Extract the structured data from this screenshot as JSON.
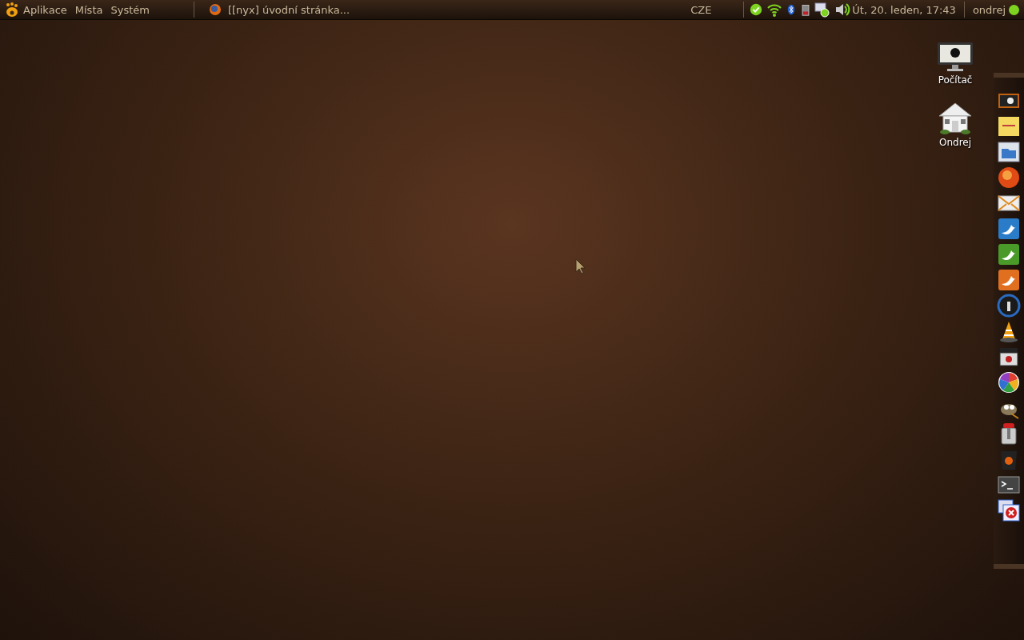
{
  "top_panel": {
    "menus": [
      {
        "label": "Aplikace"
      },
      {
        "label": "Místa"
      },
      {
        "label": "Systém"
      }
    ],
    "taskbar": [
      {
        "label": "[[nyx] úvodní stránka...",
        "selected": false
      }
    ],
    "keyboard_layout": "CZE",
    "tray": [
      {
        "kind": "chat"
      },
      {
        "kind": "wifi"
      },
      {
        "kind": "bluetooth"
      },
      {
        "kind": "battery"
      },
      {
        "kind": "messages"
      },
      {
        "kind": "volume"
      }
    ],
    "clock": "Út, 20. leden, 17:43",
    "user": {
      "name": "ondrej",
      "color": "#7ed321"
    }
  },
  "desktop_icons": [
    {
      "kind": "computer",
      "label": "Počítač"
    },
    {
      "kind": "home",
      "label": "Ondrej"
    }
  ],
  "dock": [
    {
      "kind": "screenshot"
    },
    {
      "kind": "note"
    },
    {
      "kind": "folder"
    },
    {
      "kind": "browser"
    },
    {
      "kind": "mail"
    },
    {
      "kind": "bird-blue"
    },
    {
      "kind": "bird-green"
    },
    {
      "kind": "bird-orange"
    },
    {
      "kind": "player"
    },
    {
      "kind": "cone"
    },
    {
      "kind": "clapper"
    },
    {
      "kind": "picasa"
    },
    {
      "kind": "gimp"
    },
    {
      "kind": "transmission"
    },
    {
      "kind": "trash"
    },
    {
      "kind": "terminal"
    },
    {
      "kind": "close-window"
    }
  ]
}
